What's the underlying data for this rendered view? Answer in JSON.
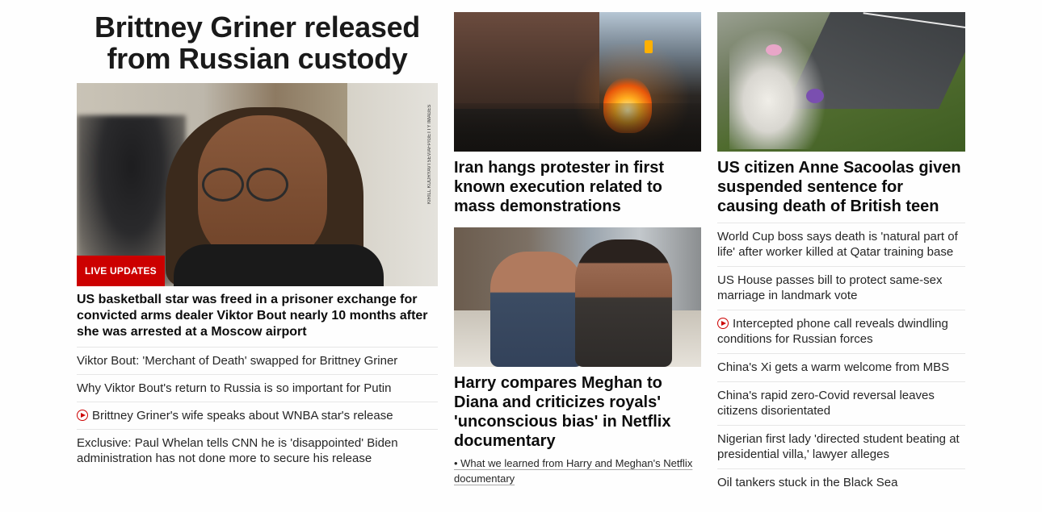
{
  "left": {
    "headline": "Brittney Griner released from Russian custody",
    "image_credit": "KIRILL KUDRYAVTSEV/AFP/GETTY IMAGES",
    "badge": "LIVE UPDATES",
    "description": "US basketball star was freed in a prisoner exchange for convicted arms dealer Viktor Bout nearly 10 months after she was arrested at a Moscow airport",
    "links": [
      {
        "text": "Viktor Bout: 'Merchant of Death' swapped for Brittney Griner",
        "video": false
      },
      {
        "text": "Why Viktor Bout's return to Russia is so important for Putin",
        "video": false
      },
      {
        "text": "Brittney Griner's wife speaks about WNBA star's release",
        "video": true
      },
      {
        "text": "Exclusive: Paul Whelan tells CNN he is 'disappointed' Biden administration has not done more to secure his release",
        "video": false
      }
    ]
  },
  "middle": {
    "card1_headline": "Iran hangs protester in first known execution related to mass demonstrations",
    "card2_headline": "Harry compares Meghan to Diana and criticizes royals' 'unconscious bias' in Netflix documentary",
    "card2_sublink": "• What we learned from Harry and Meghan's Netflix documentary"
  },
  "right": {
    "card_headline": "US citizen Anne Sacoolas given suspended sentence for causing death of British teen",
    "links": [
      {
        "text": "World Cup boss says death is 'natural part of life' after worker killed at Qatar training base",
        "video": false
      },
      {
        "text": "US House passes bill to protect same-sex marriage in landmark vote",
        "video": false
      },
      {
        "text": "Intercepted phone call reveals dwindling conditions for Russian forces",
        "video": true
      },
      {
        "text": "China's Xi gets a warm welcome from MBS",
        "video": false
      },
      {
        "text": "China's rapid zero-Covid reversal leaves citizens disorientated",
        "video": false
      },
      {
        "text": "Nigerian first lady 'directed student beating at presidential villa,' lawyer alleges",
        "video": false
      },
      {
        "text": "Oil tankers stuck in the Black Sea",
        "video": false
      }
    ]
  },
  "colors": {
    "accent_red": "#cc0000",
    "text": "#0c0c0c",
    "divider": "#e6e6e6"
  }
}
